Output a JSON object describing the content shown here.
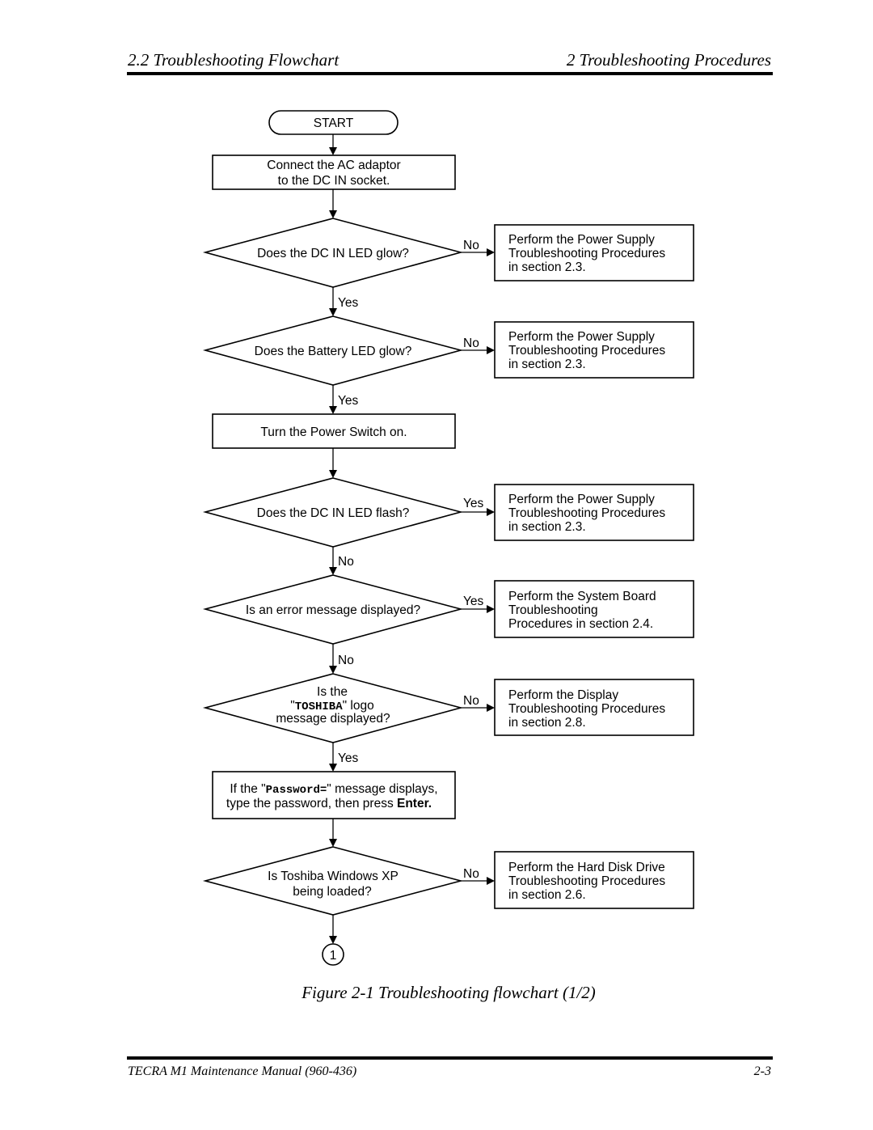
{
  "header": {
    "left": "2.2 Troubleshooting Flowchart",
    "right": "2  Troubleshooting Procedures"
  },
  "flowchart": {
    "start": "START",
    "steps": [
      {
        "id": "connect-ac",
        "type": "process",
        "lines": [
          "Connect the AC adaptor",
          "to the DC IN socket."
        ]
      },
      {
        "id": "dc-in-glow",
        "type": "decision",
        "lines": [
          "Does the DC IN LED glow?"
        ],
        "down_label": "Yes",
        "right_label": "No",
        "right_box": [
          "Perform the Power Supply",
          "Troubleshooting Procedures",
          "in section 2.3."
        ]
      },
      {
        "id": "battery-glow",
        "type": "decision",
        "lines": [
          "Does the Battery LED glow?"
        ],
        "down_label": "Yes",
        "right_label": "No",
        "right_box": [
          "Perform the Power Supply",
          "Troubleshooting Procedures",
          "in section 2.3."
        ]
      },
      {
        "id": "power-switch",
        "type": "process",
        "lines": [
          "Turn the Power Switch on."
        ]
      },
      {
        "id": "dc-in-flash",
        "type": "decision",
        "lines": [
          "Does the DC IN LED flash?"
        ],
        "down_label": "No",
        "right_label": "Yes",
        "right_box": [
          "Perform the Power Supply",
          "Troubleshooting Procedures",
          "in section 2.3."
        ]
      },
      {
        "id": "error-message",
        "type": "decision",
        "lines": [
          "Is an error message displayed?"
        ],
        "down_label": "No",
        "right_label": "Yes",
        "right_box": [
          "Perform the System Board",
          "Troubleshooting",
          "Procedures in section 2.4."
        ]
      },
      {
        "id": "toshiba-logo",
        "type": "decision",
        "lines": [
          "Is the",
          "\" TOSHIBA \" logo",
          "message displayed?"
        ],
        "line2_parts": {
          "pre": "\"",
          "code": "TOSHIBA",
          "post": "\" logo"
        },
        "down_label": "Yes",
        "right_label": "No",
        "right_box": [
          "Perform the Display",
          "Troubleshooting Procedures",
          "in section 2.8."
        ]
      },
      {
        "id": "password",
        "type": "process",
        "line1_parts": {
          "pre": "If the \"",
          "code": "Password=",
          "post": "\" message displays,"
        },
        "line2_parts": {
          "pre": "type the password, then press ",
          "bold": "Enter."
        }
      },
      {
        "id": "windows-xp",
        "type": "decision",
        "lines": [
          "Is Toshiba Windows XP",
          "being loaded?"
        ],
        "right_label": "No",
        "right_box": [
          "Perform the Hard Disk Drive",
          "Troubleshooting Procedures",
          "in section 2.6."
        ]
      }
    ],
    "connector": "1"
  },
  "caption": "Figure 2-1  Troubleshooting flowchart (1/2)",
  "footer": {
    "left": "TECRA M1 Maintenance Manual (960-436)",
    "right": "2-3"
  }
}
